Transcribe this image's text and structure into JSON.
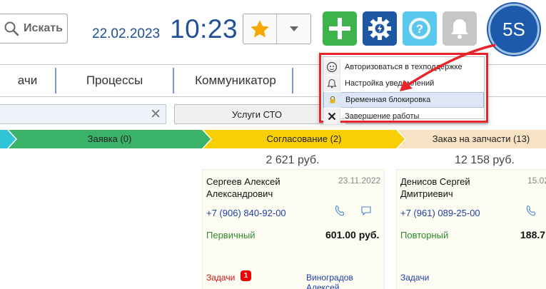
{
  "header": {
    "search_label": "Искать",
    "date": "22.02.2023",
    "time": "10:23",
    "user_initials": "5S"
  },
  "tabs": [
    {
      "label": "ачи"
    },
    {
      "label": "Процессы"
    },
    {
      "label": "Коммуникатор"
    }
  ],
  "filter": {
    "sto_label": "Услуги СТО"
  },
  "user_menu": {
    "items": [
      {
        "label": "Авторизоваться в техподдержке",
        "icon": "support-icon"
      },
      {
        "label": "Настройка уведомлений",
        "icon": "bell-icon"
      },
      {
        "label": "Временная блокировка",
        "icon": "lock-icon",
        "highlighted": true
      },
      {
        "label": "Завершение работы",
        "icon": "close-icon"
      }
    ]
  },
  "stages": [
    {
      "label": "Заявка (0)",
      "color": "#3bb26a"
    },
    {
      "label": "Согласование (2)",
      "color": "#f8cf06"
    },
    {
      "label": "Заказ на запчасти (13)",
      "color": "#f8e2c4"
    }
  ],
  "columns": [
    {
      "amount": "2 621 руб.",
      "card": {
        "name_line1": "Сергеев Алексей",
        "name_line2": "Александрович",
        "date": "23.11.2022",
        "phone": "+7 (906) 840-92-00",
        "type": "Первичный",
        "sum": "601.00 руб.",
        "tasks_label": "Задачи",
        "tasks_count": "1",
        "responsible": "Виноградов Алексей"
      }
    },
    {
      "amount": "12 158 руб.",
      "card": {
        "name_line1": "Денисов Сергей",
        "name_line2": "Дмитриевич",
        "date": "15.02",
        "phone": "+7 (961) 089-25-00",
        "type": "Повторный",
        "sum": "188.7",
        "tasks_label": "Задачи"
      }
    }
  ],
  "colors": {
    "accent_blue": "#1e57a4",
    "add_green": "#3cb44b",
    "highlight_red": "#e8242a"
  }
}
